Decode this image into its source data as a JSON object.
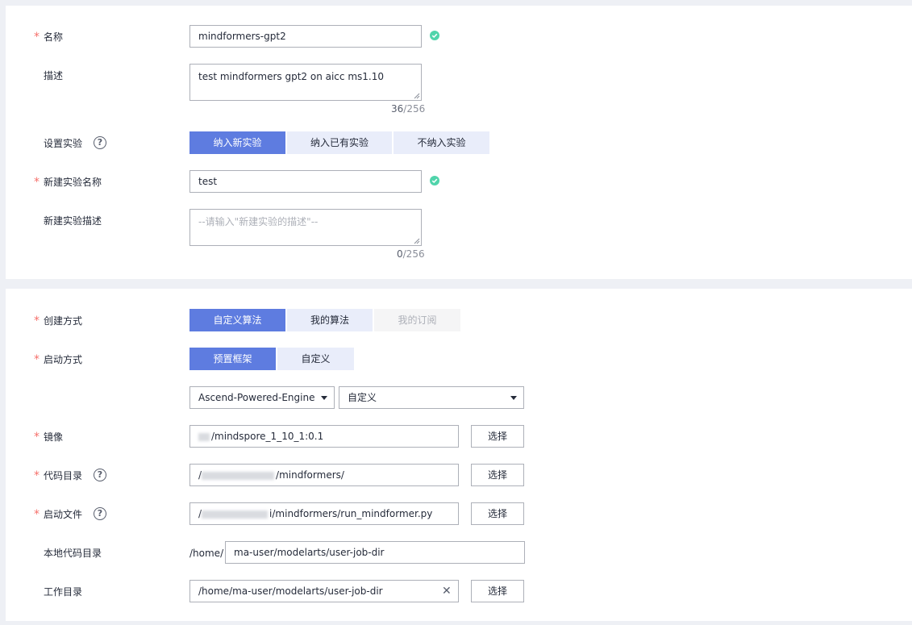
{
  "section_basic": {
    "name": {
      "required_mark": "*",
      "label": "名称",
      "value": "mindformers-gpt2"
    },
    "description": {
      "label": "描述",
      "value": "test mindformers gpt2 on aicc ms1.10",
      "count": "36",
      "max": "/256"
    },
    "experiment": {
      "label": "设置实验",
      "help": "?",
      "options": [
        "纳入新实验",
        "纳入已有实验",
        "不纳入实验"
      ],
      "selected": "纳入新实验"
    },
    "new_experiment_name": {
      "required_mark": "*",
      "label": "新建实验名称",
      "value": "test"
    },
    "new_experiment_desc": {
      "label": "新建实验描述",
      "placeholder": "--请输入\"新建实验的描述\"--",
      "count": "0",
      "max": "/256"
    }
  },
  "section_algorithm": {
    "create_method": {
      "required_mark": "*",
      "label": "创建方式",
      "options": [
        "自定义算法",
        "我的算法",
        "我的订阅"
      ],
      "selected": "自定义算法",
      "disabled": "我的订阅"
    },
    "boot_method": {
      "required_mark": "*",
      "label": "启动方式",
      "options": [
        "预置框架",
        "自定义"
      ],
      "selected": "预置框架"
    },
    "framework": {
      "engine": "Ascend-Powered-Engine",
      "version": "自定义"
    },
    "image": {
      "required_mark": "*",
      "label": "镜像",
      "value": "/mindspore_1_10_1:0.1",
      "button": "选择"
    },
    "code_dir": {
      "required_mark": "*",
      "label": "代码目录",
      "help": "?",
      "prefix": "/",
      "value": "/mindformers/",
      "button": "选择"
    },
    "boot_file": {
      "required_mark": "*",
      "label": "启动文件",
      "help": "?",
      "prefix": "/",
      "value": "i/mindformers/run_mindformer.py",
      "button": "选择"
    },
    "local_code_dir": {
      "label": "本地代码目录",
      "prefix": "/home/",
      "value": "ma-user/modelarts/user-job-dir"
    },
    "work_dir": {
      "label": "工作目录",
      "value": "/home/ma-user/modelarts/user-job-dir",
      "clear": "✕",
      "button": "选择"
    }
  },
  "colors": {
    "primary": "#5e7ce0",
    "success": "#50d4ab",
    "required": "#f66f6a"
  }
}
